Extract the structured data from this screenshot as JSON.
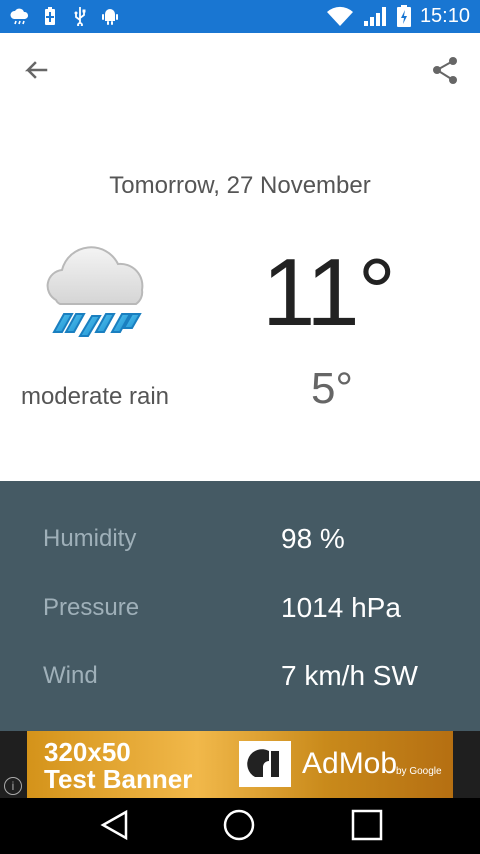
{
  "status_bar": {
    "time": "15:10",
    "icons": [
      "weather-icon",
      "battery-icon",
      "usb-icon",
      "android-icon",
      "wifi-icon",
      "signal-icon",
      "battery-charging-icon"
    ]
  },
  "forecast": {
    "date": "Tomorrow, 27 November",
    "condition": "moderate rain",
    "temp_high": "11°",
    "temp_low": "5°",
    "icon": "cloud-rain-icon"
  },
  "details": {
    "humidity": {
      "label": "Humidity",
      "value": "98 %"
    },
    "pressure": {
      "label": "Pressure",
      "value": "1014 hPa"
    },
    "wind": {
      "label": "Wind",
      "value": "7 km/h SW"
    }
  },
  "ad": {
    "line1": "320x50",
    "line2": "Test Banner",
    "brand": "AdMob",
    "by": "by Google"
  },
  "colors": {
    "status_bar": "#1976D2",
    "details_bg": "#455A64",
    "details_label": "#9FB0B9"
  }
}
